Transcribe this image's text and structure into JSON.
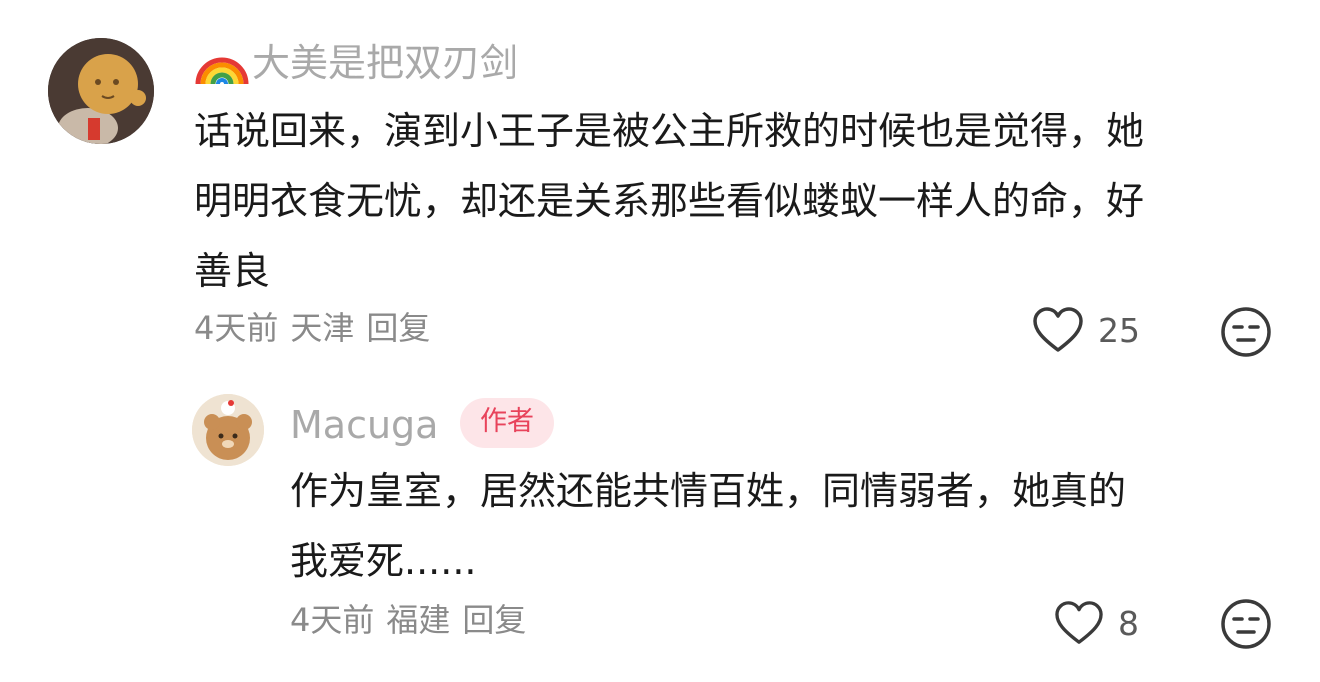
{
  "comments": [
    {
      "username": "大美是把双刃剑",
      "name_emoji": "rainbow",
      "text_lines": [
        "话说回来，演到小王子是被公主所救的时候也是觉得，她",
        "明明衣食无忧，却还是关系那些看似蝼蚁一样人的命，好",
        "善良"
      ],
      "time": "4天前",
      "location": "天津",
      "reply_label": "回复",
      "likes": "25"
    }
  ],
  "replies": [
    {
      "username": "Macuga",
      "badge": "作者",
      "text_lines": [
        "作为皇室，居然还能共情百姓，同情弱者，她真的",
        "我爱死......"
      ],
      "time": "4天前",
      "location": "福建",
      "reply_label": "回复",
      "likes": "8"
    }
  ],
  "icons": {
    "like": "heart-outline-icon",
    "dislike": "meh-face-icon",
    "badge_bg": "#fde5e8",
    "badge_fg": "#e8435b"
  }
}
